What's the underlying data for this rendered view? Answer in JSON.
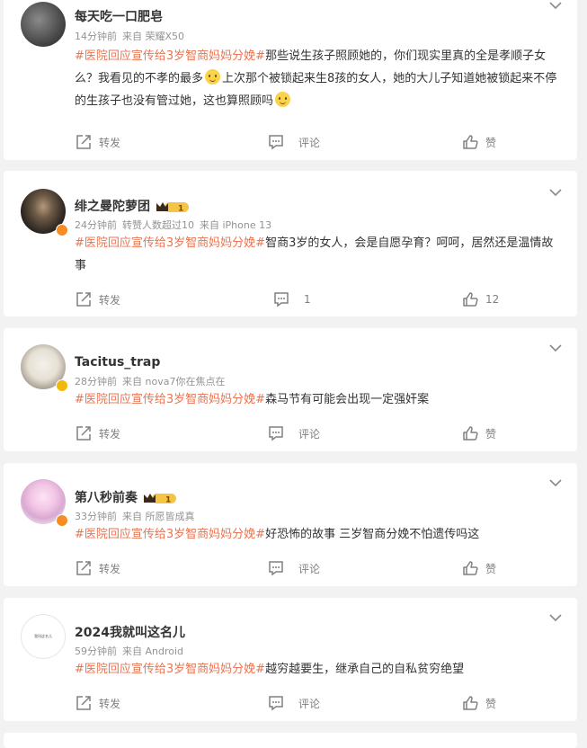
{
  "posts": [
    {
      "name": "每天吃一口肥皂",
      "time": "14分钟前",
      "source": "来自 荣耀X50",
      "topic": "#医院回应宣传给3岁智商妈妈分娩#",
      "text1": "那些说生孩子照顾她的，你们现实里真的全是孝顺子女么？我看见的不孝的最多",
      "text2": "上次那个被锁起来生8孩的女人，她的大儿子知道她被锁起来不停的生孩子也没有管过她，这也算照顾吗",
      "repost": "转发",
      "comment": "评论",
      "like": "赞"
    },
    {
      "name": "绯之曼陀萝团",
      "time": "24分钟前",
      "likes_note": "转赞人数超过10",
      "source": "来自 iPhone 13",
      "topic": "#医院回应宣传给3岁智商妈妈分娩#",
      "text1": "智商3岁的女人，会是自愿孕育？呵呵，居然还是温情故事",
      "repost": "转发",
      "comment": "1",
      "like": "12",
      "level": "1"
    },
    {
      "name": "Tacitus_trap",
      "time": "28分钟前",
      "source": "来自 nova7你在焦点在",
      "topic": "#医院回应宣传给3岁智商妈妈分娩#",
      "text1": "森马节有可能会出现一定强奸案",
      "repost": "转发",
      "comment": "评论",
      "like": "赞"
    },
    {
      "name": "第八秒前奏",
      "time": "33分钟前",
      "source": "来自 所愿皆成真",
      "topic": "#医院回应宣传给3岁智商妈妈分娩#",
      "text1": "好恐怖的故事 三岁智商分娩不怕遗传吗这",
      "repost": "转发",
      "comment": "评论",
      "like": "赞",
      "level": "1"
    },
    {
      "name": "2024我就叫这名儿",
      "time": "59分钟前",
      "source": "来自 Android",
      "topic": "#医院回应宣传给3岁智商妈妈分娩#",
      "text1": "越穷越要生，继承自己的自私贫穷绝望",
      "repost": "转发",
      "comment": "评论",
      "like": "赞",
      "avatar_text": "我叫这名儿"
    }
  ],
  "icons": {
    "repost": "repost-icon",
    "comment": "comment-icon",
    "like": "thumbs-up-icon",
    "menu": "chevron-down-icon"
  },
  "colors": {
    "topic": "#eb7350",
    "meta": "#939393",
    "badge_orange": "#f58c24",
    "badge_gold": "#f0b90b",
    "background": "#f2f2f2"
  }
}
